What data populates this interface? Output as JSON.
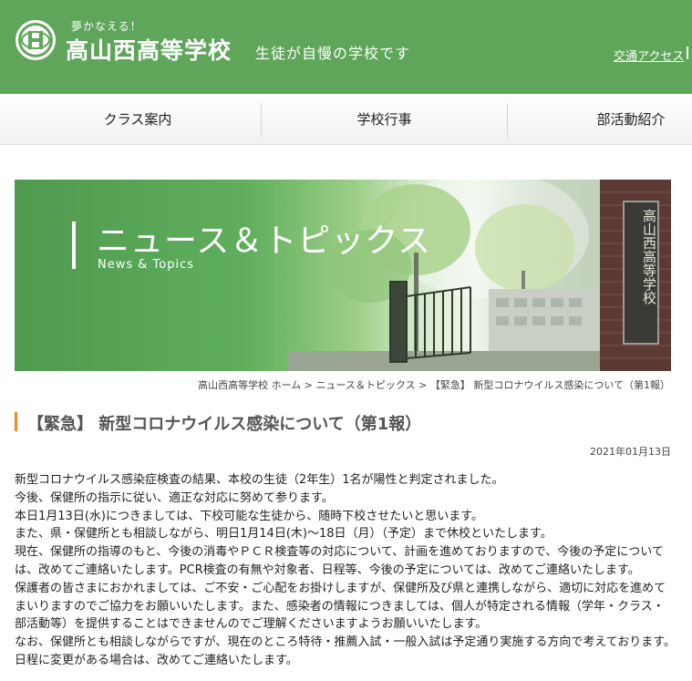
{
  "header": {
    "tagline": "夢かなえる！",
    "school_name": "高山西高等学校",
    "slogan": "生徒が自慢の学校です",
    "access_link": "交通アクセス"
  },
  "nav": {
    "items": [
      {
        "label": "クラス案内"
      },
      {
        "label": "学校行事"
      },
      {
        "label": "部活動紹介"
      }
    ]
  },
  "banner": {
    "title": "ニュース＆トピックス",
    "subtitle": "News & Topics",
    "building_sign": "高山西高等学校"
  },
  "breadcrumb": {
    "home": "高山西高等学校 ホーム",
    "section": "ニュース＆トピックス",
    "current": "【緊急】 新型コロナウイルス感染について（第1報）",
    "separator": ">"
  },
  "article": {
    "title": "【緊急】 新型コロナウイルス感染について（第1報）",
    "date": "2021年01月13日",
    "paragraphs": [
      "新型コロナウイルス感染症検査の結果、本校の生徒（2年生）1名が陽性と判定されました。",
      "今後、保健所の指示に従い、適正な対応に努めて参ります。",
      "本日1月13日(水)につきましては、下校可能な生徒から、随時下校させたいと思います。",
      "また、県・保健所とも相談しながら、明日1月14日(木)～18日（月）（予定）まで休校といたします。",
      "現在、保健所の指導のもと、今後の消毒やＰＣＲ検査等の対応について、計画を進めておりますので、今後の予定については、改めてご連絡いたします。PCR検査の有無や対象者、日程等、今後の予定については、改めてご連絡いたします。",
      "保護者の皆さまにおかれましては、ご不安・ご心配をお掛けしますが、保健所及び県と連携しながら、適切に対応を進めてまいりますのでご協力をお願いいたします。また、感染者の情報につきましては、個人が特定される情報（学年・クラス・部活動等）を提供することはできませんのでご理解くださいますようお願いいたします。",
      "なお、保健所とも相談しながらですが、現在のところ特待・推薦入試・一般入試は予定通り実施する方向で考えております。",
      "日程に変更がある場合は、改めてご連絡いたします。"
    ]
  },
  "colors": {
    "header_green": "#5fa55a",
    "title_accent": "#f08a1e"
  }
}
